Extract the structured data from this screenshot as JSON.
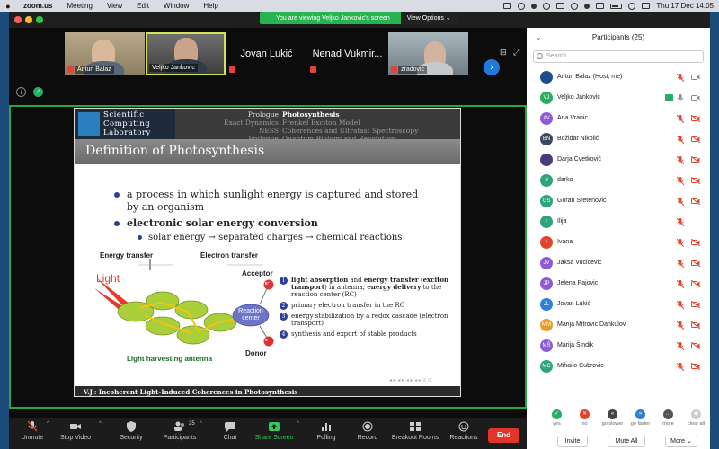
{
  "menubar": {
    "app": "zoom.us",
    "menus": [
      "Meeting",
      "View",
      "Edit",
      "Window",
      "Help"
    ],
    "clock": "Thu 17 Dec  14:05"
  },
  "banner": {
    "text": "You are viewing Veljko Jankovic's screen",
    "view_options": "View Options"
  },
  "video_tiles": [
    {
      "name": "Antun Balaz",
      "has_video": true
    },
    {
      "name": "Veljko Jankovic",
      "has_video": true,
      "active_speaker": true
    },
    {
      "name": "Jovan Lukić",
      "has_video": false
    },
    {
      "name": "Nenad Vukmir...",
      "has_video": false
    },
    {
      "name": "zradovic",
      "has_video": true
    }
  ],
  "slide": {
    "logo_lines": [
      "Scientific",
      "Computing",
      "Laboratory"
    ],
    "nav_left": [
      "Prologue",
      "Exact Dynamics",
      "NESS",
      "Epilogue"
    ],
    "nav_right": [
      "Photosynthesis",
      "Frenkel Exciton Model",
      "Coherences and Ultrafast Spectroscopy",
      "Quantum Biology and Revolution"
    ],
    "title": "Definition of Photosynthesis",
    "bullet1": "a process in which sunlight energy is captured and stored by an organism",
    "bullet2": "electronic solar energy conversion",
    "sub_bullet": "solar energy → separated charges → chemical reactions",
    "diagram": {
      "energy_transfer": "Energy transfer",
      "electron_transfer": "Electron transfer",
      "light": "Light",
      "reaction_center": "Reaction center",
      "acceptor": "Acceptor",
      "donor": "Donor",
      "antenna": "Light harvesting antenna",
      "electron": "e⁻"
    },
    "steps": [
      {
        "num": "1",
        "bold1": "light absorption",
        "text1": " and ",
        "bold2": "energy transfer",
        "text2": " (",
        "bold3": "exciton transport",
        "text3": ") in antenna; ",
        "bold4": "energy delivery",
        "text4": " to the reaction center (RC)"
      },
      {
        "num": "2",
        "text": "primary electron transfer in the RC"
      },
      {
        "num": "3",
        "text": "energy stabilization by a redox cascade (electron transport)"
      },
      {
        "num": "4",
        "text": "synthesis and export of stable products"
      }
    ],
    "footer": "V.J.: Incoherent Light-Induced Coherences in Photosynthesis"
  },
  "toolbar": {
    "unmute": "Unmute",
    "stop_video": "Stop Video",
    "security": "Security",
    "participants": "Participants",
    "participants_count": "25",
    "chat": "Chat",
    "share_screen": "Share Screen",
    "polling": "Polling",
    "record": "Record",
    "breakout_rooms": "Breakout Rooms",
    "reactions": "Reactions",
    "end": "End"
  },
  "participants_panel": {
    "title": "Participants (25)",
    "search_placeholder": "Search",
    "people": [
      {
        "initials": "",
        "name": "Antun Balaz (Host, me)",
        "color": "#1d4f8c",
        "photo": true,
        "mic": "muted",
        "cam": "on"
      },
      {
        "initials": "VJ",
        "name": "Veljko Jankovic",
        "color": "#27ae60",
        "photo": false,
        "mic": "on",
        "cam": "on",
        "sharing": true
      },
      {
        "initials": "AV",
        "name": "Ana Vranic",
        "color": "#8e5ad6",
        "photo": false,
        "mic": "muted",
        "cam": "off"
      },
      {
        "initials": "BN",
        "name": "Božidar Nikolić",
        "color": "#3b4a5c",
        "photo": false,
        "mic": "muted",
        "cam": "off"
      },
      {
        "initials": "",
        "name": "Darja Cvetković",
        "color": "#4a3b7a",
        "photo": true,
        "mic": "muted",
        "cam": "off"
      },
      {
        "initials": "d",
        "name": "darko",
        "color": "#2fa37b",
        "photo": false,
        "mic": "muted",
        "cam": "off"
      },
      {
        "initials": "GS",
        "name": "Goran Sretenovic",
        "color": "#2fa37b",
        "photo": false,
        "mic": "muted",
        "cam": "off"
      },
      {
        "initials": "I",
        "name": "Ilija",
        "color": "#2fa37b",
        "photo": false,
        "mic": "muted",
        "cam": "none"
      },
      {
        "initials": "I",
        "name": "Ivana",
        "color": "#e0452b",
        "photo": false,
        "mic": "muted",
        "cam": "off"
      },
      {
        "initials": "JV",
        "name": "Jaksa Vucicevic",
        "color": "#8e5ad6",
        "photo": false,
        "mic": "muted",
        "cam": "off"
      },
      {
        "initials": "JP",
        "name": "Jelena Pajovic",
        "color": "#8e5ad6",
        "photo": false,
        "mic": "muted",
        "cam": "off"
      },
      {
        "initials": "JL",
        "name": "Jovan Lukić",
        "color": "#2e7fd6",
        "photo": false,
        "mic": "muted",
        "cam": "off"
      },
      {
        "initials": "MM",
        "name": "Marija Mitrovic Dankulov",
        "color": "#e89a2a",
        "photo": false,
        "mic": "muted",
        "cam": "off"
      },
      {
        "initials": "MŠ",
        "name": "Marija Šindik",
        "color": "#8e5ad6",
        "photo": false,
        "mic": "muted",
        "cam": "off"
      },
      {
        "initials": "MC",
        "name": "Mihailo Cubrovic",
        "color": "#2fa37b",
        "photo": false,
        "mic": "muted",
        "cam": "off"
      }
    ],
    "reactions": [
      {
        "label": "yes",
        "color": "#27ae60",
        "glyph": "✓"
      },
      {
        "label": "no",
        "color": "#e0452b",
        "glyph": "✕"
      },
      {
        "label": "go slower",
        "color": "#444444",
        "glyph": "«"
      },
      {
        "label": "go faster",
        "color": "#2e7fd6",
        "glyph": "»"
      },
      {
        "label": "more",
        "color": "#555555",
        "glyph": "…"
      },
      {
        "label": "clear all",
        "color": "#cccccc",
        "glyph": "◆"
      }
    ],
    "invite": "Invite",
    "mute_all": "Mute All",
    "more": "More"
  }
}
